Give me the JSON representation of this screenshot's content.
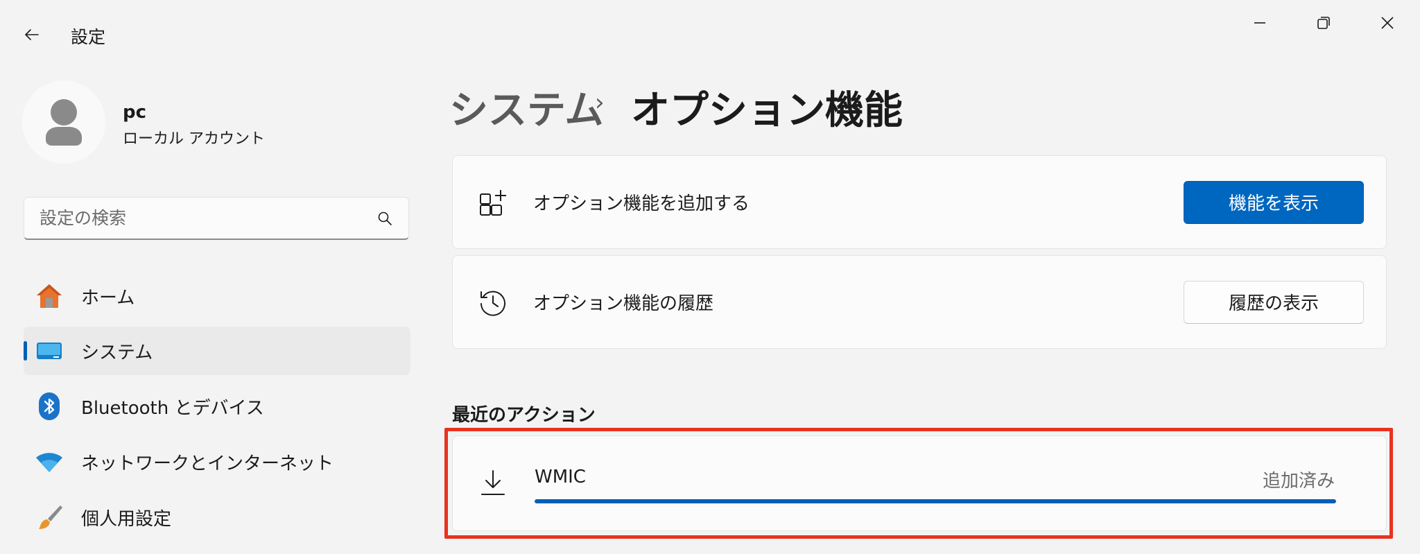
{
  "app": {
    "title": "設定"
  },
  "profile": {
    "name": "pc",
    "account_type": "ローカル アカウント"
  },
  "search": {
    "placeholder": "設定の検索"
  },
  "nav": {
    "items": [
      {
        "label": "ホーム",
        "icon": "home-icon"
      },
      {
        "label": "システム",
        "icon": "system-display-icon",
        "selected": true
      },
      {
        "label": "Bluetooth とデバイス",
        "icon": "bluetooth-icon"
      },
      {
        "label": "ネットワークとインターネット",
        "icon": "wifi-icon"
      },
      {
        "label": "個人用設定",
        "icon": "brush-icon"
      }
    ]
  },
  "breadcrumb": {
    "parent": "システム",
    "separator": "›",
    "current": "オプション機能"
  },
  "cards": {
    "add": {
      "label": "オプション機能を追加する",
      "button": "機能を表示",
      "icon": "add-apps-icon"
    },
    "history": {
      "label": "オプション機能の履歴",
      "button": "履歴の表示",
      "icon": "history-icon"
    }
  },
  "recent": {
    "title": "最近のアクション",
    "items": [
      {
        "name": "WMIC",
        "status": "追加済み",
        "progress": 1.0,
        "icon": "download-icon"
      }
    ]
  },
  "colors": {
    "accent": "#0067c0",
    "highlight": "#e8321f",
    "background": "#f3f3f3"
  }
}
